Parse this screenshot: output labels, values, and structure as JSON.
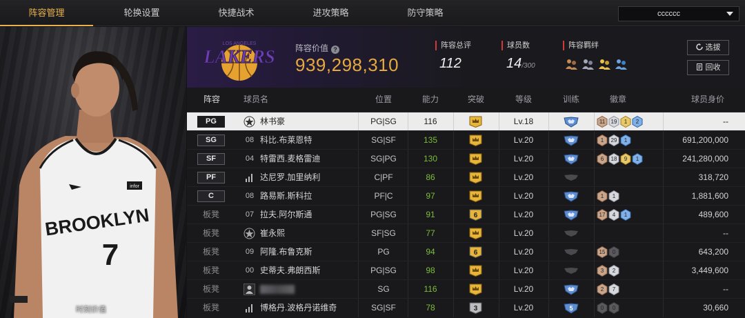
{
  "nav": {
    "tabs": [
      {
        "label": "阵容管理"
      },
      {
        "label": "轮换设置"
      },
      {
        "label": "快捷战术"
      },
      {
        "label": "进攻策略"
      },
      {
        "label": "防守策略"
      }
    ],
    "dropdown_value": "cccccc"
  },
  "player_panel": {
    "jersey_text": "BROOKLYN",
    "jersey_number": "7",
    "jersey_tag": "infor",
    "caption": "时刻价值"
  },
  "header": {
    "team_logo_text": "LAKERS",
    "team_logo_subtext": "LOS ANGELES",
    "lineup_value_label": "阵容价值",
    "lineup_value": "939,298,310",
    "rating_label": "阵容总评",
    "rating_value": "112",
    "players_label": "球员数",
    "players_value": "14",
    "players_max": "/300",
    "bond_label": "阵容羁绊",
    "select_button": "选拔",
    "recycle_button": "回收"
  },
  "table": {
    "headers": [
      "阵容",
      "球员名",
      "位置",
      "能力",
      "突破",
      "等级",
      "训练",
      "徽章",
      "球员身价"
    ],
    "rows": [
      {
        "slot": "PG",
        "bench": false,
        "icon": "star-emblem",
        "num": "",
        "name": "林书豪",
        "pos": "PG|SG",
        "ability": "116",
        "ability_green": false,
        "break": "crown",
        "level": "Lv.18",
        "train": "blue",
        "badges": [
          {
            "n": "11",
            "c": "bronze"
          },
          {
            "n": "19",
            "c": "silver"
          },
          {
            "n": "1",
            "c": "gold"
          },
          {
            "n": "2",
            "c": "blue"
          }
        ],
        "value": "--",
        "selected": true
      },
      {
        "slot": "SG",
        "bench": false,
        "icon": "",
        "num": "08",
        "name": "科比.布莱恩特",
        "pos": "SG|SF",
        "ability": "135",
        "ability_green": true,
        "break": "crown",
        "level": "Lv.20",
        "train": "blue",
        "badges": [
          {
            "n": "1",
            "c": "bronze"
          },
          {
            "n": "29",
            "c": "silver"
          },
          {
            "n": "1",
            "c": "blue"
          }
        ],
        "value": "691,200,000",
        "selected": false
      },
      {
        "slot": "SF",
        "bench": false,
        "icon": "",
        "num": "04",
        "name": "特雷西.麦格雷迪",
        "pos": "SG|PG",
        "ability": "130",
        "ability_green": true,
        "break": "crown",
        "level": "Lv.20",
        "train": "blue",
        "badges": [
          {
            "n": "6",
            "c": "bronze"
          },
          {
            "n": "18",
            "c": "silver"
          },
          {
            "n": "9",
            "c": "gold"
          },
          {
            "n": "1",
            "c": "blue"
          }
        ],
        "value": "241,280,000",
        "selected": false
      },
      {
        "slot": "PF",
        "bench": false,
        "icon": "bars",
        "num": "",
        "name": "达尼罗.加里纳利",
        "pos": "C|PF",
        "ability": "86",
        "ability_green": true,
        "break": "crown",
        "level": "Lv.20",
        "train": "gray",
        "badges": [],
        "value": "318,720",
        "selected": false
      },
      {
        "slot": "C",
        "bench": false,
        "icon": "",
        "num": "08",
        "name": "路易斯.斯科拉",
        "pos": "PF|C",
        "ability": "97",
        "ability_green": true,
        "break": "crown",
        "level": "Lv.20",
        "train": "blue",
        "badges": [
          {
            "n": "1",
            "c": "bronze"
          },
          {
            "n": "1",
            "c": "silver"
          }
        ],
        "value": "1,881,600",
        "selected": false
      },
      {
        "slot": "板凳",
        "bench": true,
        "icon": "",
        "num": "07",
        "name": "拉夫.阿尔斯通",
        "pos": "PG|SG",
        "ability": "91",
        "ability_green": true,
        "break": "six",
        "level": "Lv.20",
        "train": "blue",
        "badges": [
          {
            "n": "17",
            "c": "bronze"
          },
          {
            "n": "4",
            "c": "silver"
          },
          {
            "n": "1",
            "c": "blue"
          }
        ],
        "value": "489,600",
        "selected": false
      },
      {
        "slot": "板凳",
        "bench": true,
        "icon": "star-emblem",
        "num": "",
        "name": "崔永熙",
        "pos": "SF|SG",
        "ability": "77",
        "ability_green": true,
        "break": "crown",
        "level": "Lv.20",
        "train": "gray",
        "badges": [],
        "value": "--",
        "selected": false
      },
      {
        "slot": "板凳",
        "bench": true,
        "icon": "",
        "num": "09",
        "name": "阿隆.布鲁克斯",
        "pos": "PG",
        "ability": "94",
        "ability_green": true,
        "break": "six",
        "level": "Lv.20",
        "train": "gray",
        "badges": [
          {
            "n": "15",
            "c": "bronze"
          },
          {
            "n": "0",
            "c": "dark"
          }
        ],
        "value": "643,200",
        "selected": false
      },
      {
        "slot": "板凳",
        "bench": true,
        "icon": "",
        "num": "00",
        "name": "史蒂夫.弗朗西斯",
        "pos": "PG|SG",
        "ability": "98",
        "ability_green": true,
        "break": "crown",
        "level": "Lv.20",
        "train": "gray",
        "badges": [
          {
            "n": "3",
            "c": "bronze"
          },
          {
            "n": "2",
            "c": "silver"
          }
        ],
        "value": "3,449,600",
        "selected": false
      },
      {
        "slot": "板凳",
        "bench": true,
        "icon": "person",
        "num": "",
        "name": "",
        "pos": "SG",
        "ability": "116",
        "ability_green": true,
        "break": "crown",
        "level": "Lv.20",
        "train": "blue",
        "badges": [
          {
            "n": "2",
            "c": "bronze"
          },
          {
            "n": "7",
            "c": "silver"
          }
        ],
        "value": "--",
        "selected": false
      },
      {
        "slot": "板凳",
        "bench": true,
        "icon": "bars",
        "num": "",
        "name": "博格丹.波格丹诺维奇",
        "pos": "SG|SF",
        "ability": "78",
        "ability_green": true,
        "break": "three",
        "level": "Lv.20",
        "train": "blue5",
        "badges": [
          {
            "n": "0",
            "c": "dark"
          },
          {
            "n": "0",
            "c": "dark"
          }
        ],
        "value": "30,660",
        "selected": false
      }
    ]
  }
}
